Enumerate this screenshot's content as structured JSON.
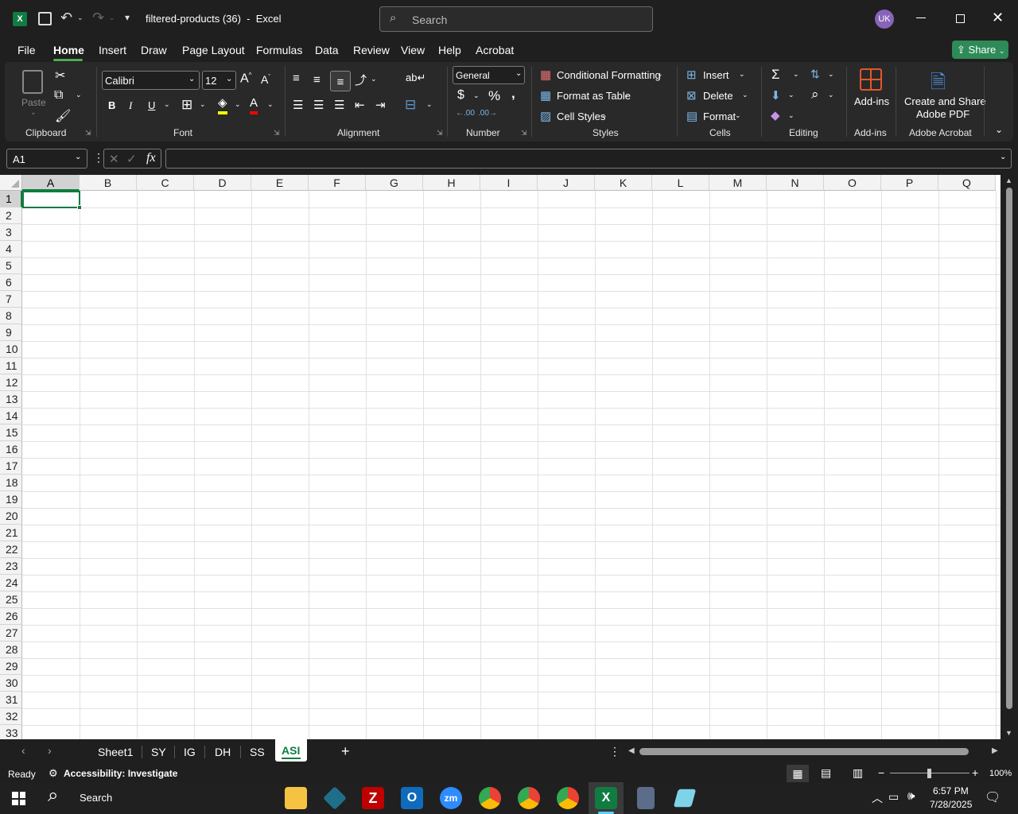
{
  "title": {
    "doc_name": "filtered-products (36)",
    "app_name": "Excel",
    "search_placeholder": "Search",
    "user_initials": "UK",
    "share_label": "Share"
  },
  "menu": [
    "File",
    "Home",
    "Insert",
    "Draw",
    "Page Layout",
    "Formulas",
    "Data",
    "Review",
    "View",
    "Help",
    "Acrobat"
  ],
  "ribbon": {
    "paste_label": "Paste",
    "font_name": "Calibri",
    "font_size": "12",
    "number_format": "General",
    "conditional_formatting": "Conditional Formatting",
    "format_as_table": "Format as Table",
    "cell_styles": "Cell Styles",
    "insert": "Insert",
    "delete": "Delete",
    "format": "Format",
    "addins": "Add-ins",
    "create_share_line1": "Create and Share",
    "create_share_line2": "Adobe PDF",
    "groups": {
      "clipboard": "Clipboard",
      "font": "Font",
      "alignment": "Alignment",
      "number": "Number",
      "styles": "Styles",
      "cells": "Cells",
      "editing": "Editing",
      "addins": "Add-ins",
      "acrobat": "Adobe Acrobat"
    }
  },
  "formula_bar": {
    "name_box": "A1",
    "formula": ""
  },
  "columns": [
    "A",
    "B",
    "C",
    "D",
    "E",
    "F",
    "G",
    "H",
    "I",
    "J",
    "K",
    "L",
    "M",
    "N",
    "O",
    "P",
    "Q"
  ],
  "rows": [
    "1",
    "2",
    "3",
    "4",
    "5",
    "6",
    "7",
    "8",
    "9",
    "10",
    "11",
    "12",
    "13",
    "14",
    "15",
    "16",
    "17",
    "18",
    "19",
    "20",
    "21",
    "22",
    "23",
    "24",
    "25",
    "26",
    "27",
    "28",
    "29",
    "30",
    "31",
    "32",
    "33"
  ],
  "sheets": [
    "Sheet1",
    "SY",
    "IG",
    "DH",
    "SS",
    "ASI"
  ],
  "active_sheet": "ASI",
  "status": {
    "ready": "Ready",
    "accessibility": "Accessibility: Investigate",
    "zoom": "100%"
  },
  "taskbar": {
    "search": "Search",
    "time": "6:57 PM",
    "date": "7/28/2025"
  }
}
